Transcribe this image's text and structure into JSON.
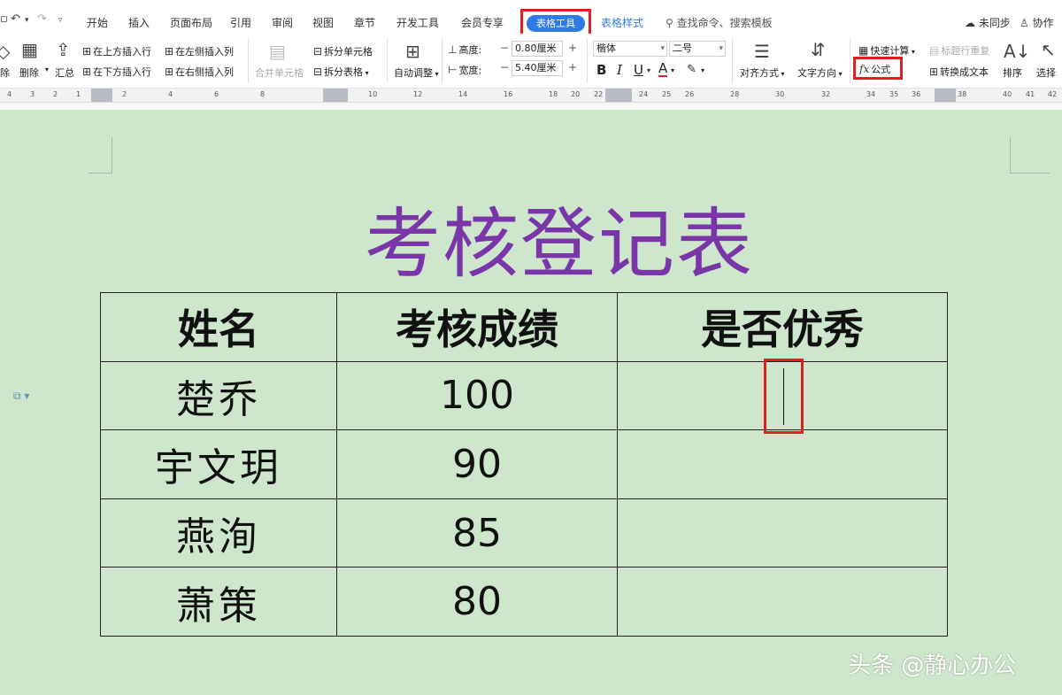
{
  "menubar": {
    "tabs": [
      "开始",
      "插入",
      "页面布局",
      "引用",
      "审阅",
      "视图",
      "章节",
      "开发工具",
      "会员专享",
      "表格工具",
      "表格样式"
    ],
    "search": "查找命令、搜索模板",
    "sync": "未同步",
    "collab": "协作"
  },
  "ribbon": {
    "clear": "除",
    "delete": "删除",
    "summary": "汇总",
    "insert_row_above": "在上方插入行",
    "insert_row_below": "在下方插入行",
    "insert_col_left": "在左侧插入列",
    "insert_col_right": "在右侧插入列",
    "merge_cells": "合并单元格",
    "split_cells": "拆分单元格",
    "split_table": "拆分表格",
    "auto_fit": "自动调整",
    "height_label": "高度:",
    "height_value": "0.80厘米",
    "width_label": "宽度:",
    "width_value": "5.40厘米",
    "font_name": "楷体",
    "font_size": "二号",
    "bold": "B",
    "italic": "I",
    "underline": "U",
    "font_color": "A",
    "align": "对齐方式",
    "text_direction": "文字方向",
    "quick_calc": "快速计算",
    "formula": "公式",
    "repeat_header": "标题行重复",
    "convert_text": "转换成文本",
    "sort": "排序",
    "select": "选择"
  },
  "ruler": {
    "numbers": [
      "4",
      "3",
      "2",
      "1",
      "2",
      "4",
      "6",
      "8",
      "10",
      "12",
      "14",
      "16",
      "18",
      "20",
      "22",
      "24",
      "25",
      "26",
      "28",
      "30",
      "32",
      "34",
      "35",
      "36",
      "38",
      "40",
      "41",
      "42"
    ]
  },
  "document": {
    "title": "考核登记表",
    "headers": [
      "姓名",
      "考核成绩",
      "是否优秀"
    ],
    "rows": [
      {
        "name": "楚乔",
        "score": "100",
        "excellent": ""
      },
      {
        "name": "宇文玥",
        "score": "90",
        "excellent": ""
      },
      {
        "name": "燕洵",
        "score": "85",
        "excellent": ""
      },
      {
        "name": "萧策",
        "score": "80",
        "excellent": ""
      }
    ]
  },
  "watermark": "头条 @静心办公",
  "colors": {
    "page_background": "#cde6cc",
    "title": "#7a35a8",
    "accent_tab": "#2f7be5",
    "highlight_box": "#e02020"
  }
}
